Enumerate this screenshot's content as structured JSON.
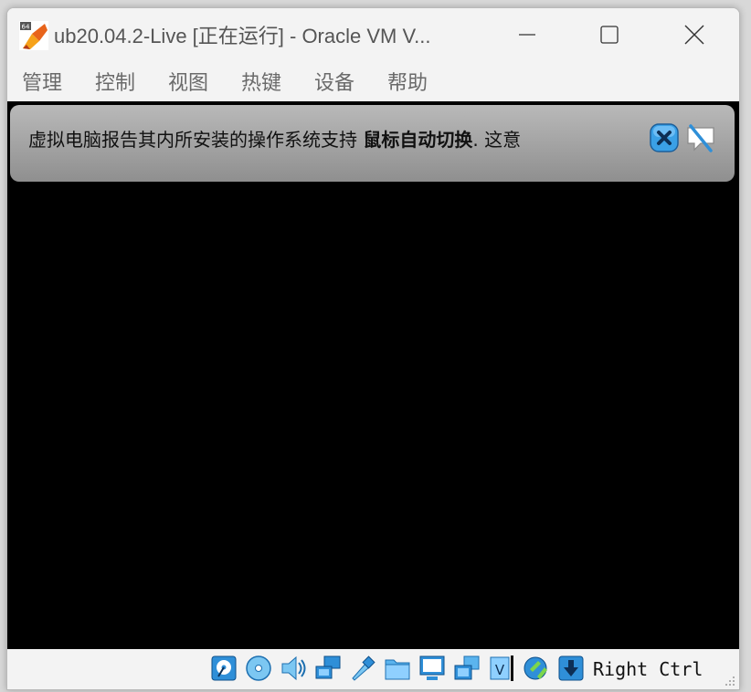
{
  "window": {
    "title": "ub20.04.2-Live [正在运行] - Oracle VM V...",
    "badge": "64"
  },
  "menu": [
    {
      "label": "管理"
    },
    {
      "label": "控制"
    },
    {
      "label": "视图"
    },
    {
      "label": "热键"
    },
    {
      "label": "设备"
    },
    {
      "label": "帮助"
    }
  ],
  "notification": {
    "text_prefix": "虚拟电脑报告其内所安装的操作系统支持",
    "text_bold": "鼠标自动切换",
    "text_suffix": ".  这意"
  },
  "statusbar": {
    "icons": [
      "hard-disk-icon",
      "optical-drive-icon",
      "audio-icon",
      "network-icon",
      "usb-icon",
      "shared-folders-icon",
      "display-icon",
      "video-capture-icon",
      "virtualization-icon",
      "mouse-integration-icon",
      "keyboard-capture-icon"
    ],
    "host_key": "Right Ctrl"
  },
  "colors": {
    "screen": "#000000",
    "chrome": "#f3f3f3",
    "icon_blue": "#2f8fd8"
  }
}
